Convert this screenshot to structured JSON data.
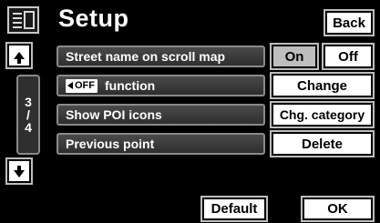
{
  "header": {
    "title": "Setup",
    "back_label": "Back",
    "menu_icon": "list-icon"
  },
  "pager": {
    "current": "3",
    "separator": "/",
    "total": "4"
  },
  "rows": [
    {
      "label": "Street name on scroll map"
    },
    {
      "chip": "OFF",
      "label": "function"
    },
    {
      "label": "Show POI icons"
    },
    {
      "label": "Previous point"
    }
  ],
  "controls": {
    "on_label": "On",
    "off_label": "Off",
    "on_selected": true,
    "change_label": "Change",
    "chg_category_label": "Chg. category",
    "delete_label": "Delete"
  },
  "footer": {
    "default_label": "Default",
    "ok_label": "OK"
  },
  "colors": {
    "background": "#000000",
    "button_face": "#ffffff",
    "selected_face": "#bdbdbd",
    "row_bar": "#3c3c3c"
  }
}
